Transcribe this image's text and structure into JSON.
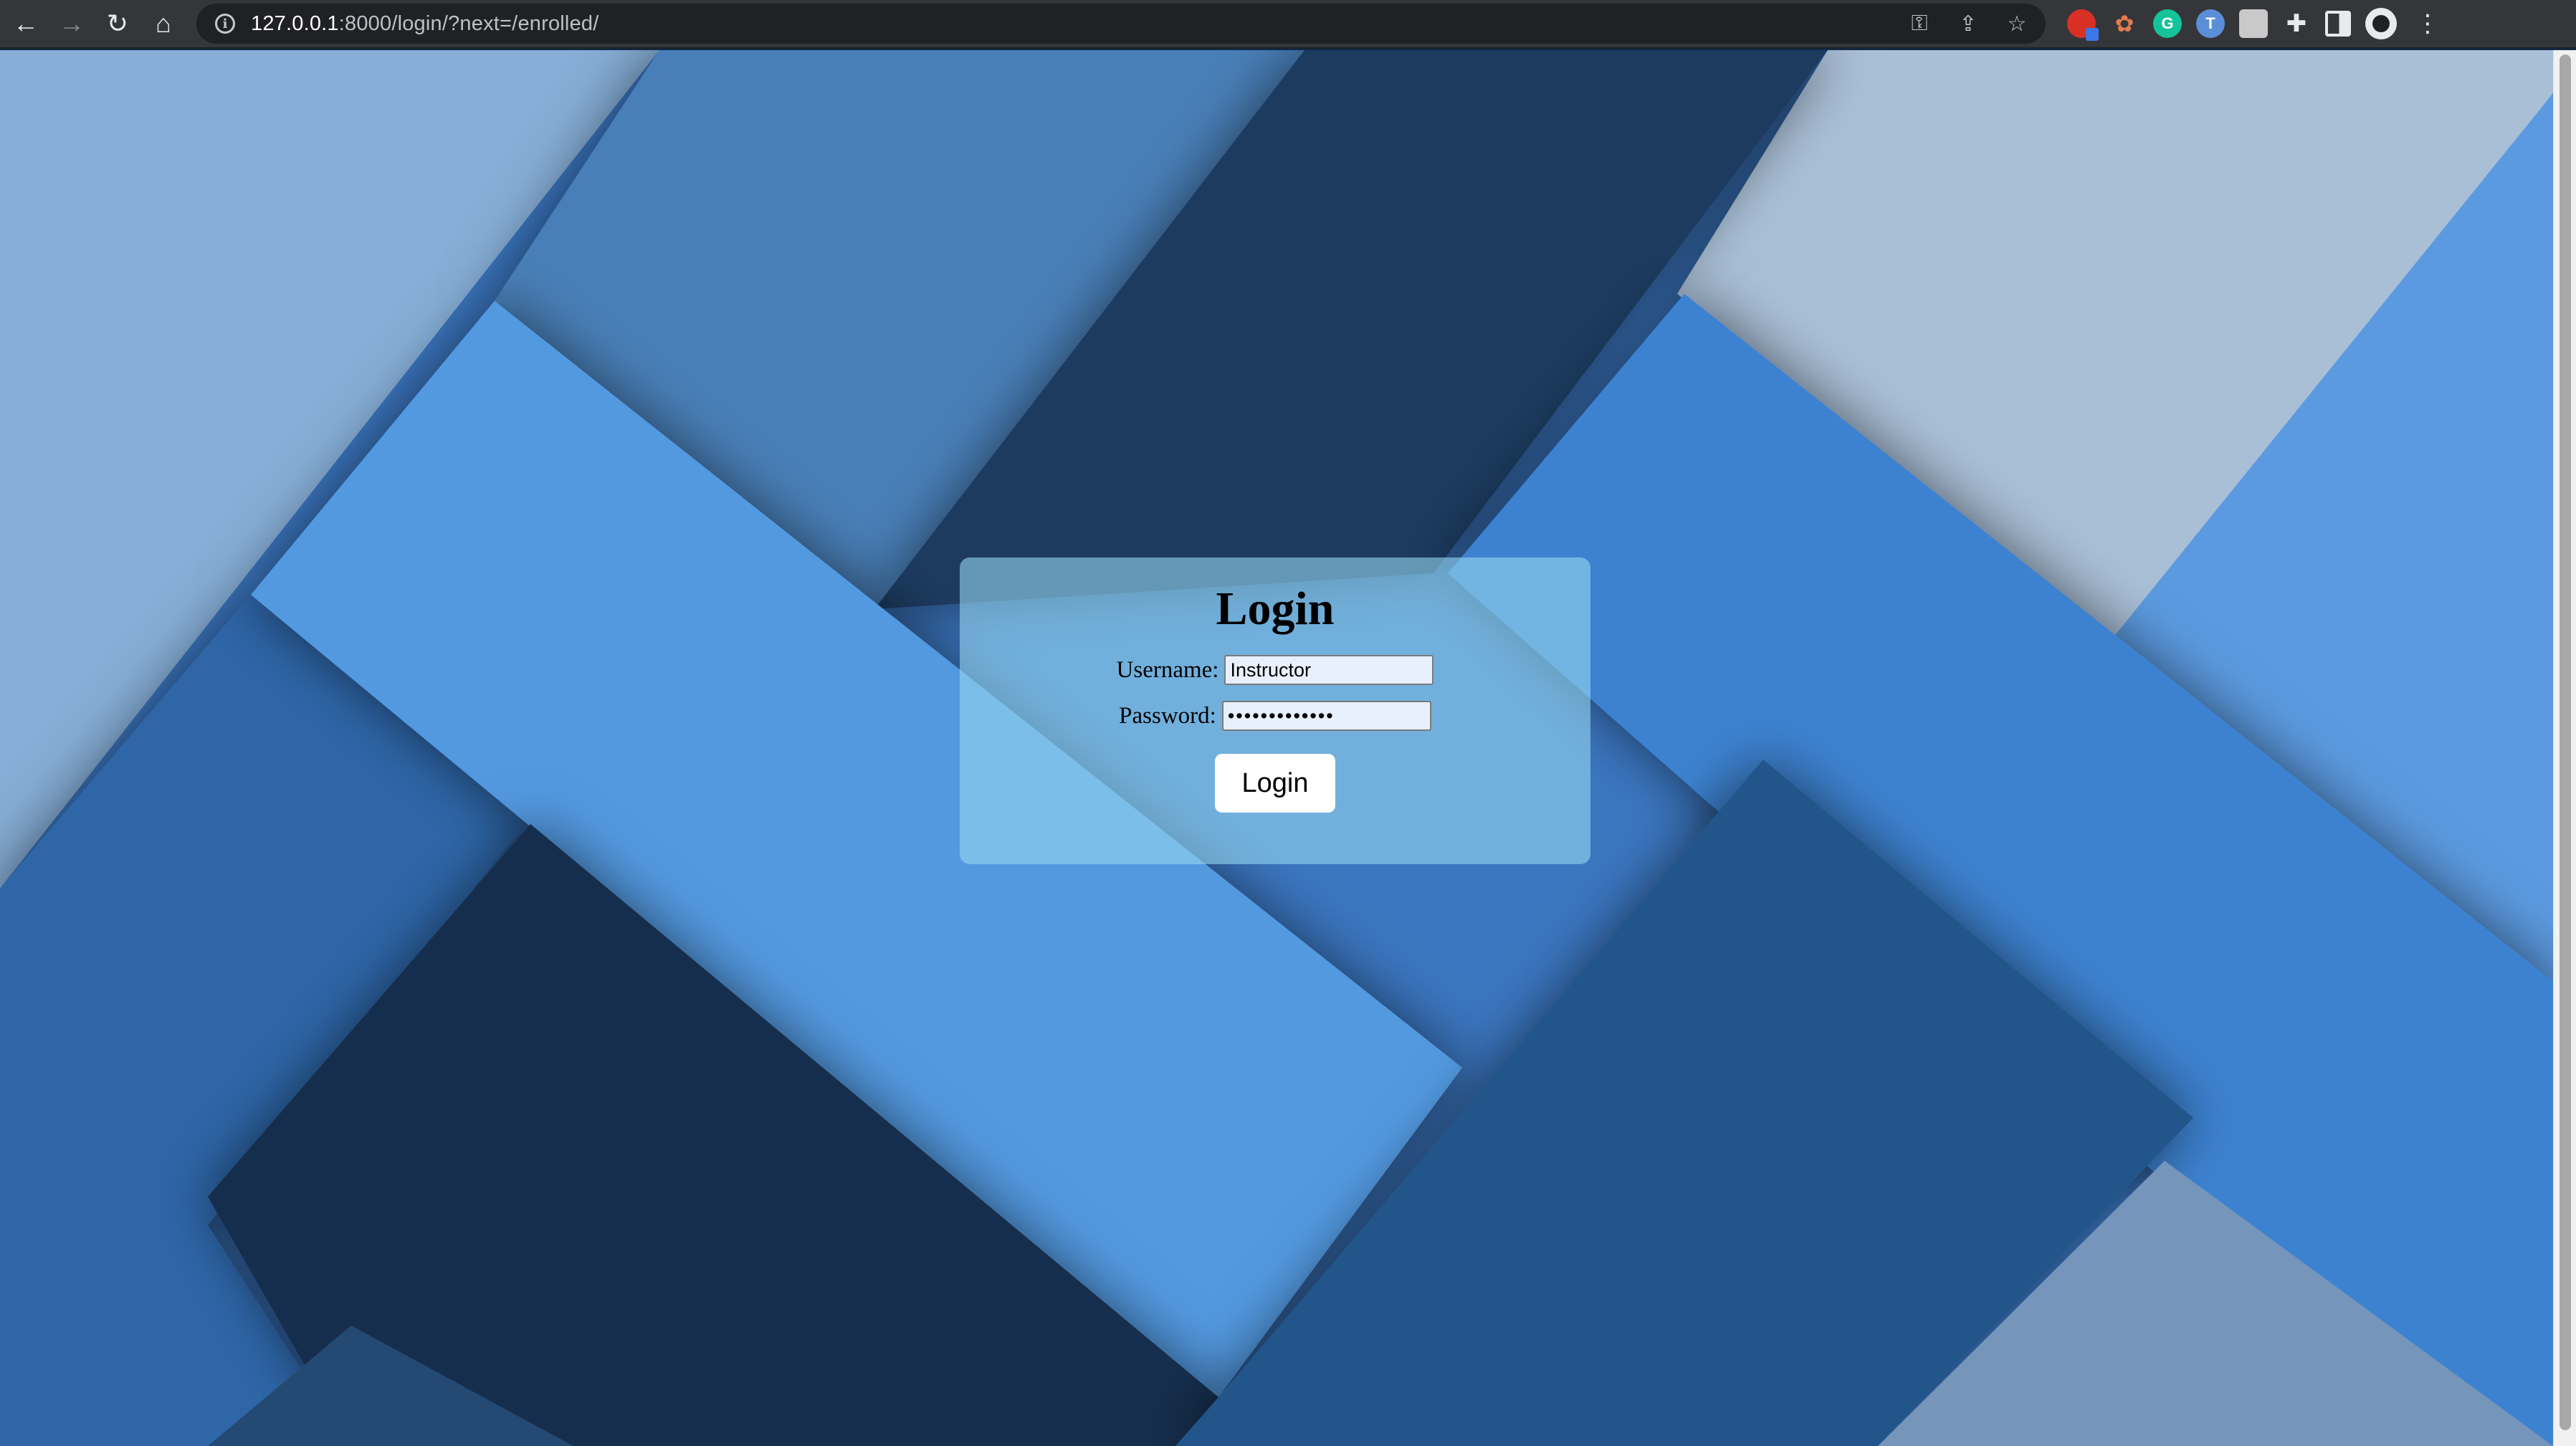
{
  "browser": {
    "url_host": "127.0.0.1",
    "url_rest": ":8000/login/?next=/enrolled/",
    "nav_icons": [
      "back-icon",
      "forward-icon",
      "reload-icon",
      "home-icon"
    ],
    "omnibox_icons": [
      "key-icon",
      "share-icon",
      "bookmark-star-icon"
    ],
    "extension_icons": [
      "extension-1-icon",
      "extension-2-icon",
      "grammarly-icon",
      "extension-t-icon",
      "extension-4-icon",
      "puzzle-icon",
      "side-panel-icon",
      "profile-avatar-icon",
      "menu-icon"
    ],
    "extension_letters": {
      "grammarly": "G",
      "ext_t": "T"
    }
  },
  "colors": {
    "chrome_bar": "#35363a",
    "omnibox": "#202124",
    "card": "rgba(150, 215, 240, 0.6)",
    "input_bg": "#e8f0fe",
    "background_blues": [
      "#0f2a4a",
      "#1b3a5f",
      "#3b7bd0",
      "#5b9ae0",
      "#a9bfd6"
    ]
  },
  "login": {
    "title": "Login",
    "username_label": "Username:",
    "username_value": "Instructor",
    "password_label": "Password:",
    "password_value": "•••••••••••••",
    "button_label": "Login"
  }
}
